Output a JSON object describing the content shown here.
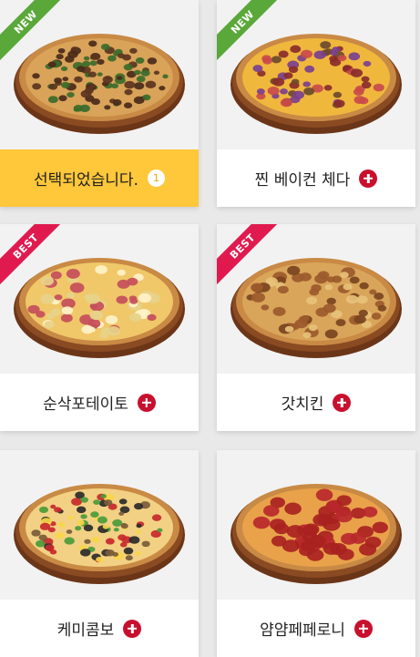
{
  "cards": [
    {
      "label": "선택되었습니다.",
      "badge": "NEW",
      "count": "1",
      "selected": true,
      "icon": "pizza-beef-icon",
      "topping": "beef"
    },
    {
      "label": "찐 베이컨 체다",
      "badge": "NEW",
      "selected": false,
      "icon": "pizza-bacon-cheddar-icon",
      "topping": "bacon"
    },
    {
      "label": "순삭포테이토",
      "badge": "BEST",
      "selected": false,
      "icon": "pizza-potato-icon",
      "topping": "potato"
    },
    {
      "label": "갓치킨",
      "badge": "BEST",
      "selected": false,
      "icon": "pizza-chicken-icon",
      "topping": "chicken"
    },
    {
      "label": "케미콤보",
      "badge": "",
      "selected": false,
      "icon": "pizza-combo-icon",
      "topping": "combo"
    },
    {
      "label": "얌얌페페로니",
      "badge": "",
      "selected": false,
      "icon": "pizza-pepperoni-icon",
      "topping": "pepperoni"
    }
  ],
  "colors": {
    "selected": "#ffc73a",
    "plus": "#c8102e",
    "new_ribbon": "#5aa83a",
    "best_ribbon": "#e01a4f"
  }
}
